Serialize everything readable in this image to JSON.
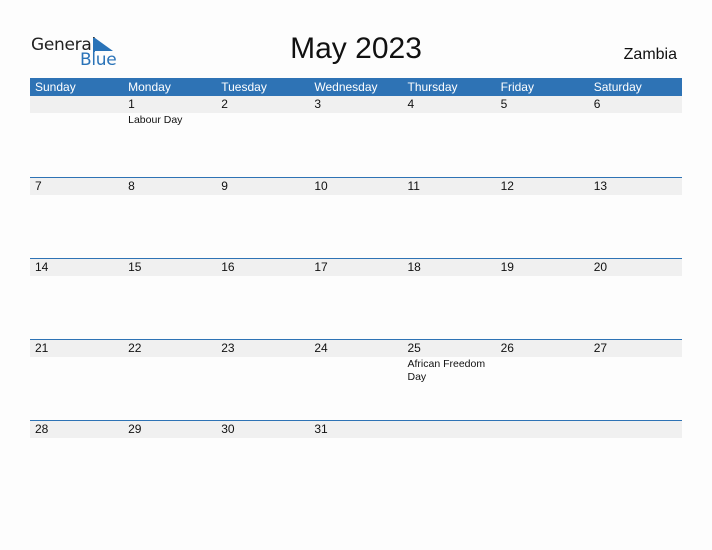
{
  "logo": {
    "general": "General",
    "blue": "Blue"
  },
  "title": "May 2023",
  "country": "Zambia",
  "colors": {
    "accent": "#2e73b5",
    "row_bg": "#f0f0f0"
  },
  "weekdays": [
    "Sunday",
    "Monday",
    "Tuesday",
    "Wednesday",
    "Thursday",
    "Friday",
    "Saturday"
  ],
  "weeks": [
    {
      "days": [
        "",
        "1",
        "2",
        "3",
        "4",
        "5",
        "6"
      ],
      "events": [
        "",
        "Labour Day",
        "",
        "",
        "",
        "",
        ""
      ]
    },
    {
      "days": [
        "7",
        "8",
        "9",
        "10",
        "11",
        "12",
        "13"
      ],
      "events": [
        "",
        "",
        "",
        "",
        "",
        "",
        ""
      ]
    },
    {
      "days": [
        "14",
        "15",
        "16",
        "17",
        "18",
        "19",
        "20"
      ],
      "events": [
        "",
        "",
        "",
        "",
        "",
        "",
        ""
      ]
    },
    {
      "days": [
        "21",
        "22",
        "23",
        "24",
        "25",
        "26",
        "27"
      ],
      "events": [
        "",
        "",
        "",
        "",
        "African Freedom Day",
        "",
        ""
      ]
    },
    {
      "days": [
        "28",
        "29",
        "30",
        "31",
        "",
        "",
        ""
      ],
      "events": [
        "",
        "",
        "",
        "",
        "",
        "",
        ""
      ]
    }
  ]
}
